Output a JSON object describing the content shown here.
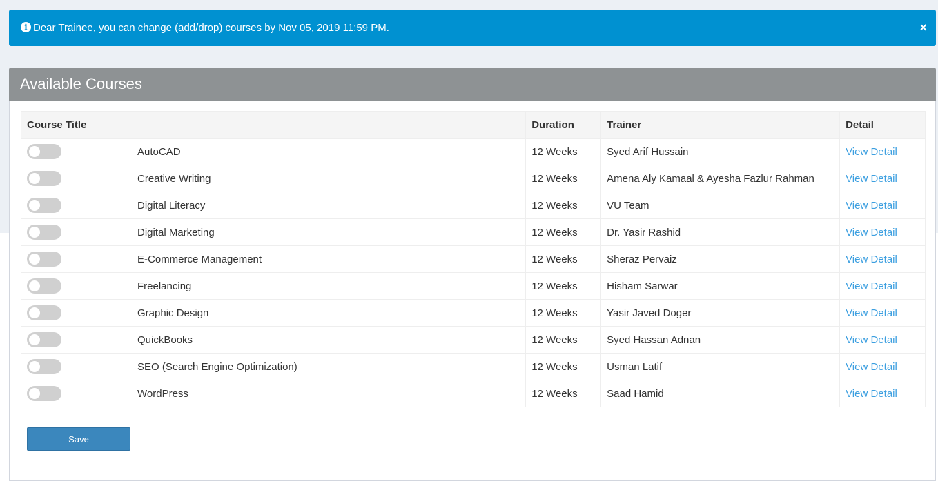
{
  "alert": {
    "icon": "info-circle-icon",
    "icon_glyph": "i",
    "message": "Dear Trainee, you can change (add/drop) courses by Nov 05, 2019 11:59 PM.",
    "close_glyph": "×",
    "background_color": "#0091d1"
  },
  "panel": {
    "title": "Available Courses",
    "header_color": "#8e9294"
  },
  "table": {
    "columns": {
      "course_title": "Course Title",
      "duration": "Duration",
      "trainer": "Trainer",
      "detail": "Detail"
    },
    "rows": [
      {
        "enrolled": false,
        "title": "AutoCAD",
        "duration": "12 Weeks",
        "trainer": "Syed Arif Hussain",
        "detail": "View Detail"
      },
      {
        "enrolled": false,
        "title": "Creative Writing",
        "duration": "12 Weeks",
        "trainer": "Amena Aly Kamaal & Ayesha Fazlur Rahman",
        "detail": "View Detail"
      },
      {
        "enrolled": false,
        "title": "Digital Literacy",
        "duration": "12 Weeks",
        "trainer": "VU Team",
        "detail": "View Detail"
      },
      {
        "enrolled": false,
        "title": "Digital Marketing",
        "duration": "12 Weeks",
        "trainer": "Dr. Yasir Rashid",
        "detail": "View Detail"
      },
      {
        "enrolled": false,
        "title": "E-Commerce Management",
        "duration": "12 Weeks",
        "trainer": "Sheraz Pervaiz",
        "detail": "View Detail"
      },
      {
        "enrolled": false,
        "title": "Freelancing",
        "duration": "12 Weeks",
        "trainer": "Hisham Sarwar",
        "detail": "View Detail"
      },
      {
        "enrolled": false,
        "title": "Graphic Design",
        "duration": "12 Weeks",
        "trainer": "Yasir Javed Doger",
        "detail": "View Detail"
      },
      {
        "enrolled": false,
        "title": "QuickBooks",
        "duration": "12 Weeks",
        "trainer": "Syed Hassan Adnan",
        "detail": "View Detail"
      },
      {
        "enrolled": false,
        "title": "SEO (Search Engine Optimization)",
        "duration": "12 Weeks",
        "trainer": "Usman Latif",
        "detail": "View Detail"
      },
      {
        "enrolled": false,
        "title": "WordPress",
        "duration": "12 Weeks",
        "trainer": "Saad Hamid",
        "detail": "View Detail"
      }
    ]
  },
  "actions": {
    "save_label": "Save",
    "save_color": "#3b87bd"
  }
}
